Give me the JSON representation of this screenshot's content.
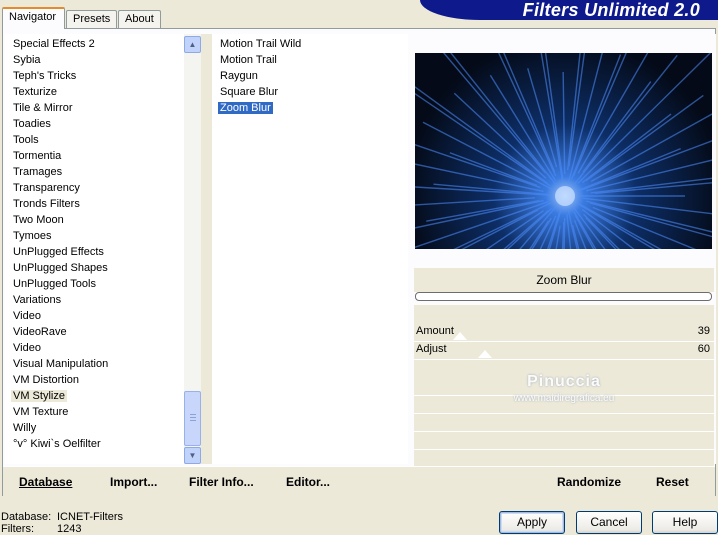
{
  "tabs": [
    {
      "label": "Navigator",
      "active": true
    },
    {
      "label": "Presets",
      "active": false
    },
    {
      "label": "About",
      "active": false
    }
  ],
  "banner": {
    "title": "Filters Unlimited 2.0",
    "color": "#0e1a8c"
  },
  "categories": [
    "Special Effects 2",
    "Sybia",
    "Teph's Tricks",
    "Texturize",
    "Tile & Mirror",
    "Toadies",
    "Tools",
    "Tormentia",
    "Tramages",
    "Transparency",
    "Tronds Filters",
    "Two Moon",
    "Tymoes",
    "UnPlugged Effects",
    "UnPlugged Shapes",
    "UnPlugged Tools",
    "Variations",
    "Video",
    "VideoRave",
    "Video",
    "Visual Manipulation",
    "VM Distortion",
    "VM Stylize",
    "VM Texture",
    "Willy",
    "°v° Kiwi`s Oelfilter"
  ],
  "selected_category": "VM Stylize",
  "filters": [
    "Motion Trail Wild",
    "Motion Trail",
    "Raygun",
    "Square Blur",
    "Zoom Blur"
  ],
  "selected_filter": "Zoom Blur",
  "preview": {
    "filter_name": "Zoom Blur",
    "watermark_name": "Pinuccia",
    "watermark_url": "www.maidiregrafica.eu"
  },
  "params": [
    {
      "label": "Amount",
      "value": "39",
      "fraction": 0.153
    },
    {
      "label": "Adjust",
      "value": "60",
      "fraction": 0.235
    }
  ],
  "bottom_bar": {
    "database": "Database",
    "import": "Import...",
    "filter_info": "Filter Info...",
    "editor": "Editor...",
    "randomize": "Randomize",
    "reset": "Reset"
  },
  "status": {
    "database_label": "Database:",
    "database_value": "ICNET-Filters",
    "filters_label": "Filters:",
    "filters_value": "1243"
  },
  "buttons": {
    "apply": "Apply",
    "cancel": "Cancel",
    "help": "Help"
  },
  "colors": {
    "selection": "#316ac5",
    "accent": "#e68b2c",
    "face": "#ece9d8"
  }
}
